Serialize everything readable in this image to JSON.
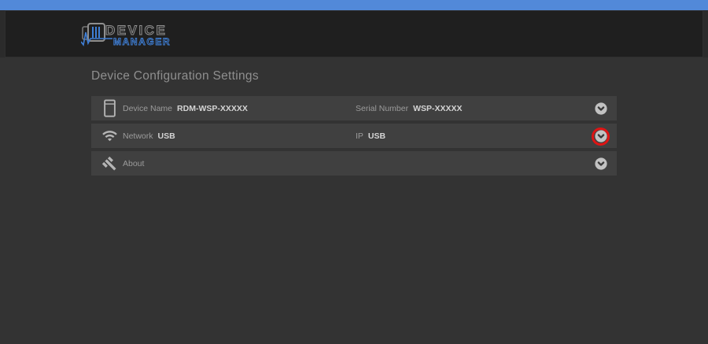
{
  "header": {
    "logo": {
      "line1": "DEVICE",
      "line2": "MANAGER"
    }
  },
  "page": {
    "title": "Device Configuration Settings"
  },
  "settings_rows": [
    {
      "id": "device-info",
      "icon": "tablet-device-icon",
      "primary": {
        "label": "Device Name",
        "value": "RDM-WSP-XXXXX"
      },
      "secondary": {
        "label": "Serial Number",
        "value": "WSP-XXXXX"
      },
      "expandable": true,
      "highlighted": false
    },
    {
      "id": "network",
      "icon": "wifi-icon",
      "primary": {
        "label": "Network",
        "value": "USB"
      },
      "secondary": {
        "label": "IP",
        "value": "USB"
      },
      "expandable": true,
      "highlighted": true
    },
    {
      "id": "about",
      "icon": "gavel-icon",
      "primary": {
        "label": "About",
        "value": ""
      },
      "expandable": true,
      "highlighted": false
    }
  ],
  "annotation": {
    "type": "red-circle-highlight",
    "target": "network-row-expand-button",
    "color": "#de1414"
  },
  "colors": {
    "topbar_blue": "#5289d9",
    "header_bg": "#1f1f1f",
    "page_bg": "#333333",
    "row_bg": "#404040",
    "logo_blue": "#3f7fd6"
  }
}
